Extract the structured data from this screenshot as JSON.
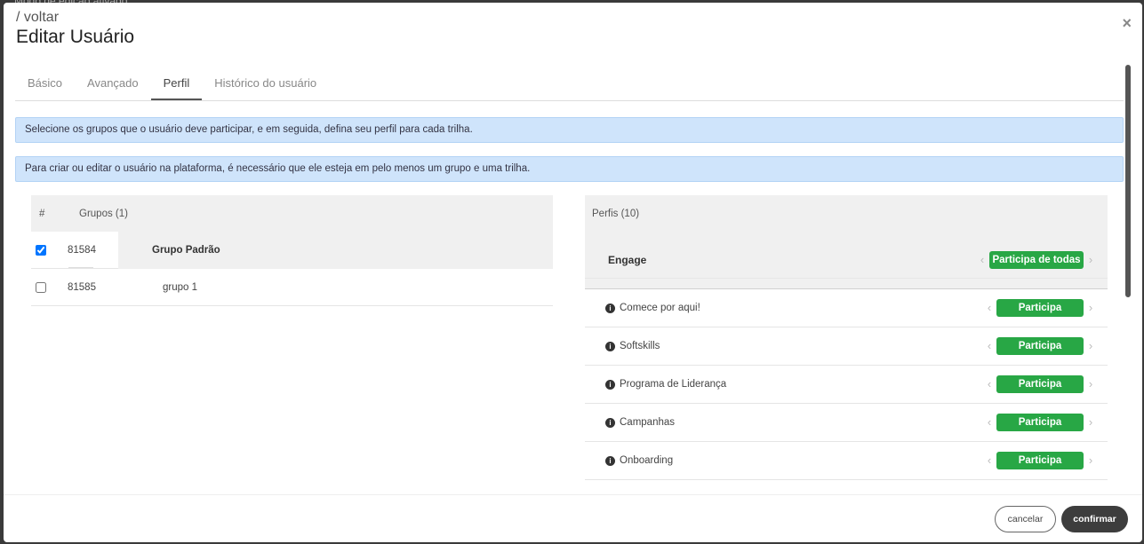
{
  "backdrop": {
    "text": "Modo de edição ativado"
  },
  "modal": {
    "back_link": "/ voltar",
    "title": "Editar Usuário",
    "close_glyph": "×"
  },
  "tabs": [
    {
      "label": "Básico",
      "active": false
    },
    {
      "label": "Avançado",
      "active": false
    },
    {
      "label": "Perfil",
      "active": true
    },
    {
      "label": "Histórico do usuário",
      "active": false
    }
  ],
  "alerts": [
    "Selecione os grupos que o usuário deve participar, e em seguida, defina seu perfil para cada trilha.",
    "Para criar ou editar o usuário na plataforma, é necessário que ele esteja em pelo menos um grupo e uma trilha."
  ],
  "groups": {
    "hash_header": "#",
    "title": "Grupos (1)",
    "rows": [
      {
        "id": "81584",
        "name": "Grupo Padrão",
        "checked": true
      },
      {
        "id": "81585",
        "name": "grupo 1",
        "checked": false
      }
    ]
  },
  "profiles": {
    "title": "Perfis (10)",
    "engage": {
      "label": "Engage",
      "value": "Participa de todas"
    },
    "rows": [
      {
        "label": "Comece por aqui!",
        "value": "Participa"
      },
      {
        "label": "Softskills",
        "value": "Participa"
      },
      {
        "label": "Programa de Liderança",
        "value": "Participa"
      },
      {
        "label": "Campanhas",
        "value": "Participa"
      },
      {
        "label": "Onboarding",
        "value": "Participa"
      }
    ],
    "chevron_left": "‹",
    "chevron_right": "›",
    "info_glyph": "i"
  },
  "footer": {
    "cancel_label": "cancelar",
    "confirm_label": "confirmar"
  },
  "colors": {
    "pill_green": "#28a745",
    "alert_blue": "#cfe4fb",
    "confirm_dark": "#3d3d3d"
  }
}
